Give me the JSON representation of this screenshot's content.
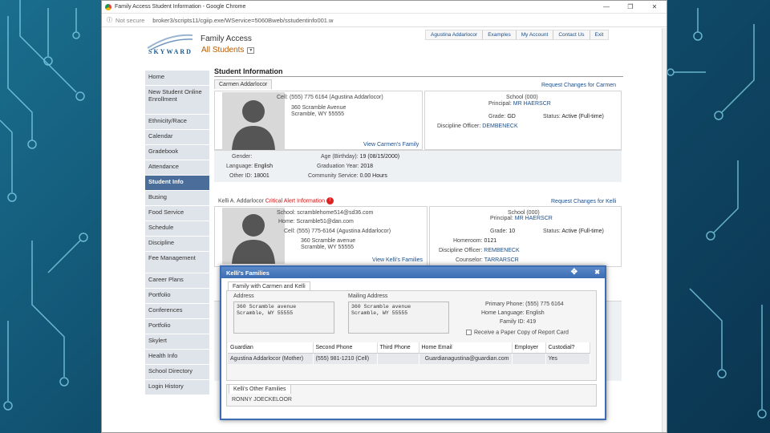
{
  "browser": {
    "window_title": "Family Access Student Information - Google Chrome",
    "security": "Not secure",
    "url": "broker3/scripts11/cgiip.exe/WService=5060Bweb/sstudentinfo001.w"
  },
  "header": {
    "logo_text": "SKYWARD",
    "app_title": "Family Access",
    "scope": "All Students",
    "user_links": [
      "Agustina Addarlocor",
      "Examples",
      "My Account",
      "Contact Us",
      "Exit"
    ]
  },
  "sidebar": {
    "items": [
      {
        "label": "Home"
      },
      {
        "label": "New Student Online Enrollment"
      },
      {
        "label": "Ethnicity/Race"
      },
      {
        "label": "Calendar"
      },
      {
        "label": "Gradebook"
      },
      {
        "label": "Attendance"
      },
      {
        "label": "Student Info",
        "active": true
      },
      {
        "label": "Busing"
      },
      {
        "label": "Food Service"
      },
      {
        "label": "Schedule"
      },
      {
        "label": "Discipline"
      },
      {
        "label": "Fee Management"
      },
      {
        "label": "Career Plans"
      },
      {
        "label": "Portfolio"
      },
      {
        "label": "Conferences"
      },
      {
        "label": "Portfolio"
      },
      {
        "label": "Skylert"
      },
      {
        "label": "Health Info"
      },
      {
        "label": "School Directory"
      },
      {
        "label": "Login History"
      }
    ]
  },
  "main": {
    "title": "Student Information",
    "student1": {
      "tab": "Carmen Addarlocor",
      "request_link": "Request Changes for Carmen",
      "cell": "Cell: (555) 775 6164 (Agustina Addarlocor)",
      "address1": "360 Scramble Avenue",
      "address2": "Scramble, WY 55555",
      "family_link": "View Carmen's Family",
      "school": "School (000)",
      "principal_label": "Principal:",
      "principal": "MR HAERSCR",
      "grade_label": "Grade:",
      "grade": "GD",
      "status_label": "Status:",
      "status": "Active (Full-time)",
      "discipline_label": "Discipline Officer:",
      "discipline": "DEMBENECK",
      "gender_label": "Gender:",
      "gender": "",
      "language_label": "Language:",
      "language": "English",
      "other_id_label": "Other ID:",
      "other_id": "18001",
      "age_label": "Age (Birthday):",
      "age": "19 (08/15/2000)",
      "grad_label": "Graduation Year:",
      "grad": "2018",
      "service_label": "Community Service:",
      "service": "0.00 Hours"
    },
    "student2": {
      "name": "Kelli A. Addarlocor",
      "alert": "Critical Alert Information",
      "alert_count": "!",
      "request_link": "Request Changes for Kelli",
      "school_email": "School: scramblehome514@sd36.com",
      "home_email": "Home: Scramble51@dan.com",
      "cell": "Cell: (555) 775-6164 (Agustina Addarlocor)",
      "address1": "360 Scramble avenue",
      "address2": "Scramble, WY 55555",
      "family_link": "View Kelli's Families",
      "school": "School (000)",
      "principal_label": "Principal:",
      "principal": "MR HAERSCR",
      "grade_label": "Grade:",
      "grade": "10",
      "status_label": "Status:",
      "status": "Active (Full-time)",
      "homeroom_label": "Homeroom:",
      "homeroom": "0121",
      "discipline_label": "Discipline Officer:",
      "discipline": "REMBENECK",
      "counselor_label": "Counselor:",
      "counselor": "TARRARSCR"
    }
  },
  "modal": {
    "title": "Kelli's Families",
    "tab": "Family with Carmen and Kelli",
    "address_label": "Address",
    "address": "360 Scramble avenue\nScramble, WY 55555",
    "mailing_label": "Mailing Address",
    "mailing": "360 Scramble avenue\nScramble, WY 55555",
    "primary_phone": "Primary Phone: (555) 775 6164",
    "home_language": "Home Language: English",
    "family_id": "Family ID: 419",
    "paper_copy": "Receive a Paper Copy of Report Card",
    "table": {
      "headers": [
        "Guardian",
        "Second Phone",
        "Third Phone",
        "Home Email",
        "Employer",
        "Custodial?"
      ],
      "rows": [
        [
          "Agustina Addarlocor (Mother)",
          "(555) 981-1210 (Cell)",
          "",
          "Guardianagustina@guardian.com",
          "",
          "Yes"
        ]
      ]
    },
    "other_tab": "Kelli's Other Families",
    "other_name": "RONNY JOECKELOOR"
  }
}
